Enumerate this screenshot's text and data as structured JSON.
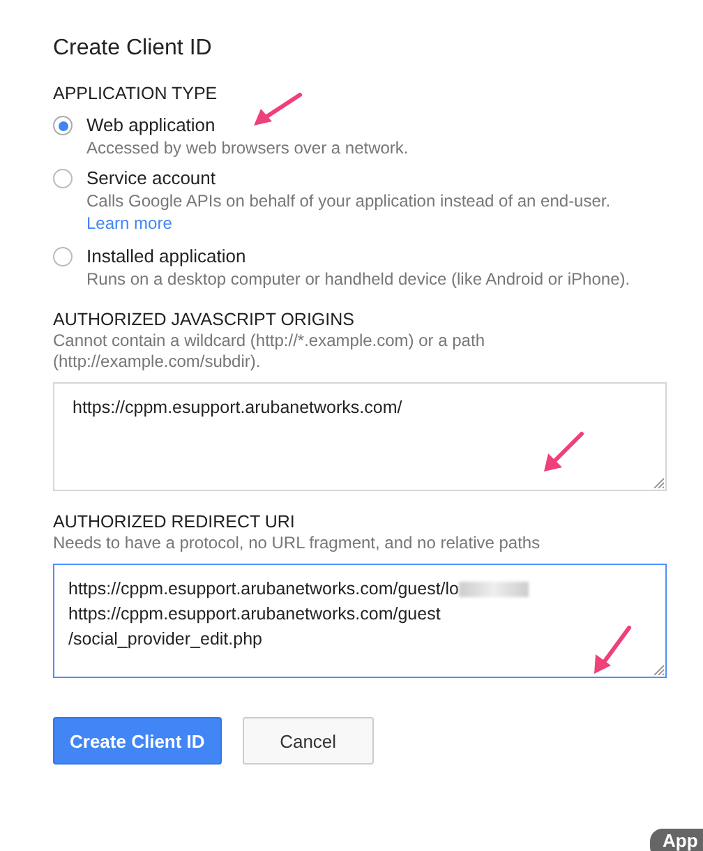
{
  "title": "Create Client ID",
  "application_type": {
    "label": "APPLICATION TYPE",
    "options": [
      {
        "label": "Web application",
        "description": "Accessed by web browsers over a network.",
        "selected": true
      },
      {
        "label": "Service account",
        "description": "Calls Google APIs on behalf of your application instead of an end-user.",
        "link": "Learn more",
        "selected": false
      },
      {
        "label": "Installed application",
        "description": "Runs on a desktop computer or handheld device (like Android or iPhone).",
        "selected": false
      }
    ]
  },
  "fields": [
    {
      "label": "AUTHORIZED JAVASCRIPT ORIGINS",
      "hint": "Cannot contain a wildcard (http://*.example.com) or a path (http://example.com/subdir).",
      "lines": [
        {
          "text": "https://cppm.esupport.arubanetworks.com/",
          "blurred": false
        }
      ],
      "focused": false
    },
    {
      "label": "AUTHORIZED REDIRECT URI",
      "hint": "Needs to have a protocol, no URL fragment, and no relative paths",
      "lines": [
        {
          "text": "https://cppm.esupport.arubanetworks.com/guest/lo",
          "blurred": true
        },
        {
          "text": "https://cppm.esupport.arubanetworks.com/guest",
          "blurred": false
        },
        {
          "text": "/social_provider_edit.php",
          "blurred": false
        }
      ],
      "focused": true
    }
  ],
  "buttons": [
    {
      "label": "Create Client ID",
      "kind": "primary"
    },
    {
      "label": "Cancel",
      "kind": "secondary"
    }
  ],
  "corner_badge": "App"
}
